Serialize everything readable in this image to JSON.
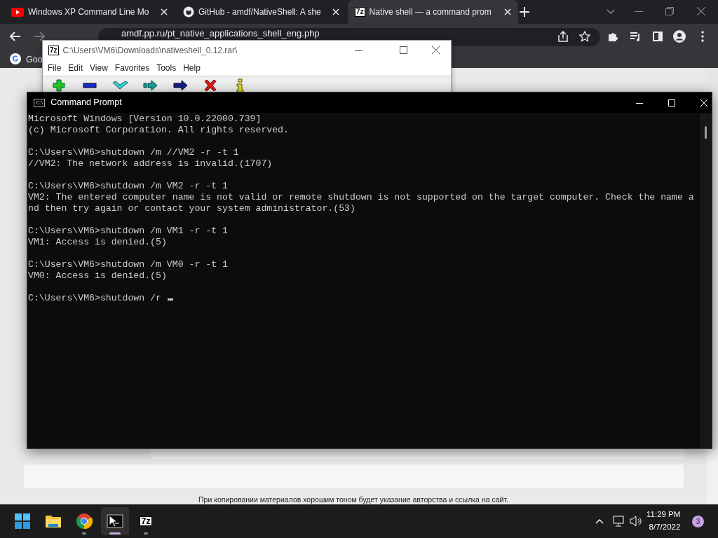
{
  "browser": {
    "tabs": [
      {
        "title": "Windows XP Command Line Mo",
        "kind": "video",
        "selected": false
      },
      {
        "title": "GitHub - amdf/NativeShell: A she",
        "kind": "repo",
        "selected": false
      },
      {
        "title": "Native shell — a command prom",
        "kind": "archive",
        "icon_text": "7z",
        "selected": true
      }
    ],
    "address": "amdf.pp.ru/pt_native_applications_shell_eng.php",
    "bookmarks": [
      "Goo"
    ],
    "footer": "При копировании материалов хорошим тоном будет указание авторства и ссылка на сайт."
  },
  "archiver": {
    "logo": "7z",
    "title": "C:\\Users\\VM6\\Downloads\\nativeshell_0.12.rar\\",
    "menu": [
      "File",
      "Edit",
      "View",
      "Favorites",
      "Tools",
      "Help"
    ],
    "toolbar": [
      {
        "kind": "add"
      },
      {
        "kind": "remove"
      },
      {
        "kind": "test"
      },
      {
        "kind": "copy"
      },
      {
        "kind": "move"
      },
      {
        "kind": "delete"
      },
      {
        "kind": "info"
      }
    ]
  },
  "console": {
    "icon_text": "C:\\",
    "title": "Command Prompt",
    "blocks": [
      [
        "Microsoft Windows [Version 10.0.22000.739]",
        "(c) Microsoft Corporation. All rights reserved."
      ],
      [
        "C:\\Users\\VM6>shutdown /m //VM2 -r -t 1",
        "//VM2: The network address is invalid.(1707)"
      ],
      [
        "C:\\Users\\VM6>shutdown /m VM2 -r -t 1",
        "VM2: The entered computer name is not valid or remote shutdown is not supported on the target computer. Check the name a",
        "nd then try again or contact your system administrator.(53)"
      ],
      [
        "C:\\Users\\VM6>shutdown /m VM1 -r -t 1",
        "VM1: Access is denied.(5)"
      ],
      [
        "C:\\Users\\VM6>shutdown /m VM0 -r -t 1",
        "VM0: Access is denied.(5)"
      ],
      [
        "C:\\Users\\VM6>shutdown /r "
      ]
    ]
  },
  "taskbar": {
    "apps": [
      {
        "kind": "start",
        "running": false,
        "selected": false
      },
      {
        "kind": "explorer",
        "running": false,
        "selected": false
      },
      {
        "kind": "chrome",
        "running": true,
        "selected": false
      },
      {
        "kind": "terminal",
        "running": true,
        "selected": true
      },
      {
        "kind": "archiver",
        "label": "7z",
        "running": true,
        "selected": false
      }
    ],
    "time": "11:29 PM",
    "date": "8/7/2022",
    "badge": "3"
  }
}
